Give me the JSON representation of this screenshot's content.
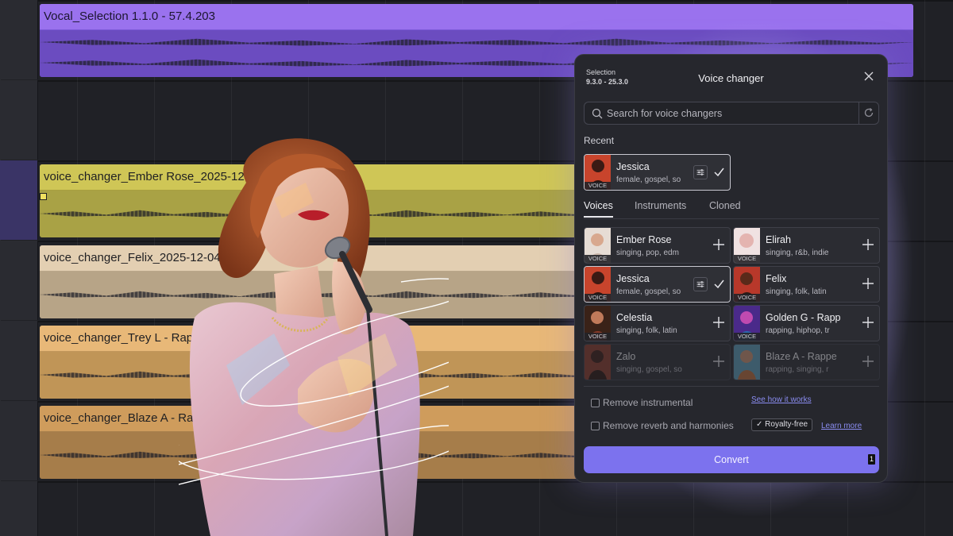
{
  "tracks": [
    {
      "title": "Vocal_Selection 1.1.0 - 57.4.203"
    },
    {
      "title": "voice_changer_Ember Rose_2025-12-0"
    },
    {
      "title": "voice_changer_Felix_2025-12-04-"
    },
    {
      "title": "voice_changer_Trey L - Rapp"
    },
    {
      "title": "voice_changer_Blaze A - Rapper_"
    }
  ],
  "panel": {
    "selection_label": "Selection",
    "selection_range": "9.3.0 - 25.3.0",
    "title": "Voice changer",
    "search_placeholder": "Search for voice changers",
    "recent_label": "Recent",
    "recent": {
      "name": "Jessica",
      "tags": "female, gospel, so",
      "tag": "VOICE"
    },
    "tabs": [
      {
        "label": "Voices"
      },
      {
        "label": "Instruments"
      },
      {
        "label": "Cloned"
      }
    ],
    "voices": [
      {
        "name": "Ember Rose",
        "tags": "singing, pop, edm",
        "tag": "VOICE"
      },
      {
        "name": "Elirah",
        "tags": "singing, r&b, indie",
        "tag": "VOICE"
      },
      {
        "name": "Jessica",
        "tags": "female, gospel, so",
        "tag": "VOICE"
      },
      {
        "name": "Felix",
        "tags": "singing, folk, latin",
        "tag": "VOICE"
      },
      {
        "name": "Celestia",
        "tags": "singing, folk, latin",
        "tag": "VOICE"
      },
      {
        "name": "Golden G - Rapp",
        "tags": "rapping, hiphop, tr",
        "tag": "VOICE"
      },
      {
        "name": "Zalo",
        "tags": "singing, gospel, so"
      },
      {
        "name": "Blaze A - Rappe",
        "tags": "rapping, singing, r"
      }
    ],
    "remove_instrumental": "Remove instrumental",
    "see_how": "See how it works",
    "remove_reverb": "Remove reverb and harmonies",
    "royalty_free": "✓ Royalty-free",
    "learn_more": "Learn more",
    "convert": "Convert",
    "convert_badge": "1"
  },
  "colors": {
    "accent": "#7c72ee",
    "vocal_clip": "#9a72ee",
    "panel_bg": "#26272d"
  }
}
